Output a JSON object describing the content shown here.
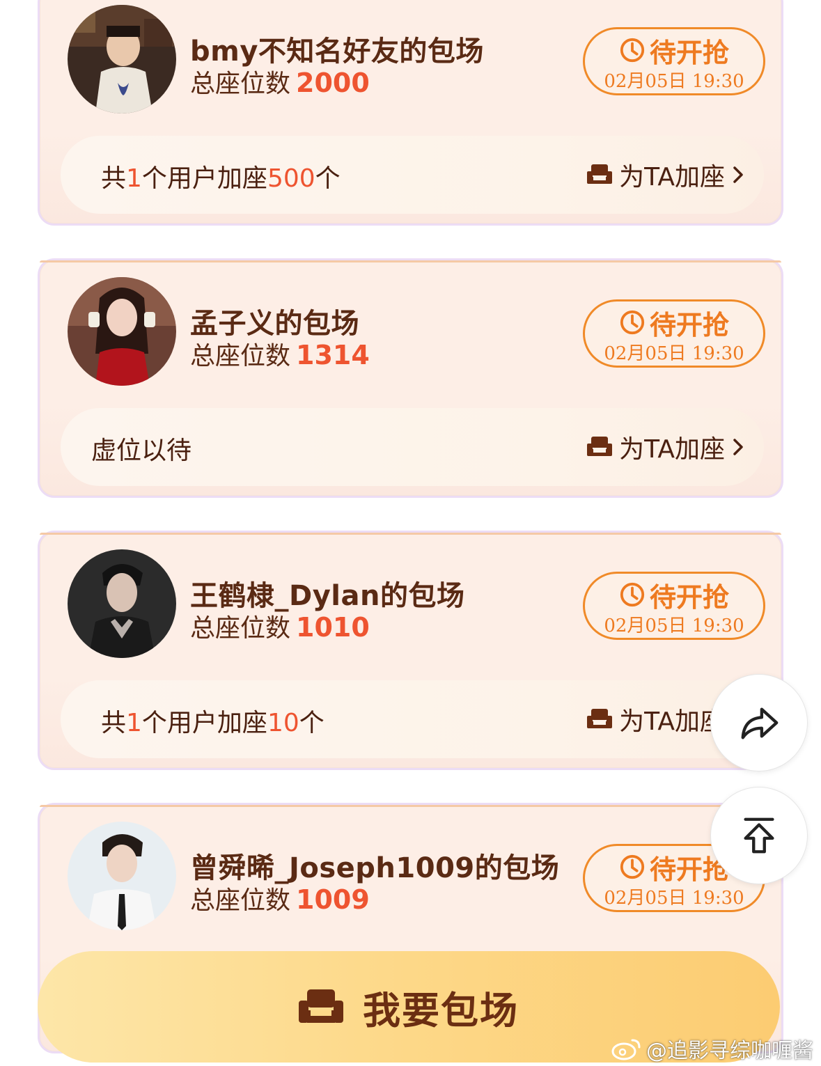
{
  "cards": [
    {
      "title": "bmy不知名好友的包场",
      "seat_label": "总座位数",
      "seat_count": "2000",
      "status_label": "待开抢",
      "status_time": "02月05日 19:30",
      "info_prefix": "共",
      "info_users": "1",
      "info_mid": "个用户加座",
      "info_seats": "500",
      "info_suffix": "个",
      "add_seat_label": "为TA加座",
      "avatar_icon": "avatar-costume-man"
    },
    {
      "title": "孟子义的包场",
      "seat_label": "总座位数",
      "seat_count": "1314",
      "status_label": "待开抢",
      "status_time": "02月05日 19:30",
      "info_text": "虚位以待",
      "add_seat_label": "为TA加座",
      "avatar_icon": "avatar-woman-red-dress"
    },
    {
      "title": "王鹤棣_Dylan的包场",
      "seat_label": "总座位数",
      "seat_count": "1010",
      "status_label": "待开抢",
      "status_time": "02月05日 19:30",
      "info_prefix": "共",
      "info_users": "1",
      "info_mid": "个用户加座",
      "info_seats": "10",
      "info_suffix": "个",
      "add_seat_label": "为TA加座",
      "avatar_icon": "avatar-man-dark"
    },
    {
      "title": "曾舜晞_Joseph1009的包场",
      "seat_label": "总座位数",
      "seat_count": "1009",
      "status_label": "待开抢",
      "status_time": "02月05日 19:30",
      "avatar_icon": "avatar-man-suit"
    }
  ],
  "cta": {
    "label": "我要包场",
    "icon": "sofa-icon"
  },
  "float_buttons": {
    "share_icon": "share-icon",
    "top_icon": "back-to-top-icon"
  },
  "watermark": {
    "text": "@追影寻综咖喱酱",
    "icon": "weibo-icon"
  },
  "colors": {
    "accent_orange": "#ee7a20",
    "count_red": "#ee5430",
    "text_brown": "#5a2a14",
    "cta_yellow": "#fdd888"
  }
}
